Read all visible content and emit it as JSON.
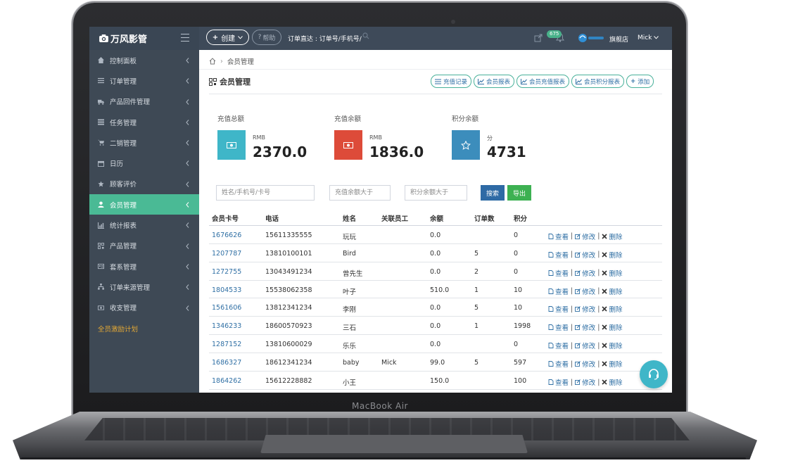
{
  "device": {
    "label": "MacBook Air"
  },
  "app": {
    "name": "万风影管",
    "brand_color": "#3e4a59",
    "accent": "#4aba95"
  },
  "topbar": {
    "create_label": "创建",
    "help_label": "帮助",
    "order_search_label": "订单直达 : 订单号/手机号/",
    "notif_count": "675",
    "store_name": "旗舰店",
    "user_name": "Mick"
  },
  "sidebar": {
    "items": [
      {
        "label": "控制面板",
        "icon": "dashboard-icon"
      },
      {
        "label": "订单管理",
        "icon": "list-icon"
      },
      {
        "label": "产品回件管理",
        "icon": "truck-icon"
      },
      {
        "label": "任务管理",
        "icon": "tasks-icon"
      },
      {
        "label": "二销管理",
        "icon": "cart-icon"
      },
      {
        "label": "日历",
        "icon": "calendar-icon"
      },
      {
        "label": "顾客评价",
        "icon": "star-half-icon"
      },
      {
        "label": "会员管理",
        "icon": "user-icon",
        "active": true
      },
      {
        "label": "统计报表",
        "icon": "bar-chart-icon"
      },
      {
        "label": "产品管理",
        "icon": "qrcode-icon"
      },
      {
        "label": "套系管理",
        "icon": "id-card-icon"
      },
      {
        "label": "订单来源管理",
        "icon": "sitemap-icon"
      },
      {
        "label": "收支管理",
        "icon": "money-icon"
      },
      {
        "label": "全员激励计划",
        "icon": "",
        "special": true
      }
    ]
  },
  "breadcrumb": {
    "current": "会员管理"
  },
  "page": {
    "title": "会员管理",
    "buttons": [
      "充值记录",
      "会员报表",
      "会员充值报表",
      "会员积分报表",
      "添加"
    ]
  },
  "stats": [
    {
      "label": "充值总额",
      "unit": "RMB",
      "value": "2370.0",
      "color": "#3fb6c8",
      "icon": "money-icon"
    },
    {
      "label": "充值余额",
      "unit": "RMB",
      "value": "1836.0",
      "color": "#dd4b39",
      "icon": "money-icon"
    },
    {
      "label": "积分余额",
      "unit": "分",
      "value": "4731",
      "color": "#3c8dbc",
      "icon": "star-icon"
    }
  ],
  "filters": {
    "name_placeholder": "姓名/手机号/卡号",
    "balance_placeholder": "充值余额大于",
    "points_placeholder": "积分余额大于",
    "search_label": "搜索",
    "export_label": "导出"
  },
  "table": {
    "headers": [
      "会员卡号",
      "电话",
      "姓名",
      "关联员工",
      "余额",
      "订单数",
      "积分"
    ],
    "ops": {
      "view": "查看",
      "edit": "修改",
      "delete": "删除",
      "sep": "|"
    },
    "rows": [
      [
        "1676626",
        "15611335555",
        "玩玩",
        "",
        "0.0",
        "",
        "0"
      ],
      [
        "1207787",
        "13810100101",
        "Bird",
        "",
        "0.0",
        "5",
        "0"
      ],
      [
        "1272755",
        "13043491234",
        "曾先生",
        "",
        "0.0",
        "2",
        "0"
      ],
      [
        "1804533",
        "15538062358",
        "叶子",
        "",
        "510.0",
        "1",
        "10"
      ],
      [
        "1561606",
        "13812341234",
        "李刚",
        "",
        "0.0",
        "5",
        "10"
      ],
      [
        "1346233",
        "18600570923",
        "三石",
        "",
        "0.0",
        "1",
        "1998"
      ],
      [
        "1287152",
        "13810600029",
        "乐乐",
        "",
        "0.0",
        "",
        "0"
      ],
      [
        "1686327",
        "18612341234",
        "baby",
        "Mick",
        "99.0",
        "5",
        "597"
      ],
      [
        "1864262",
        "15612228882",
        "小王",
        "",
        "150.0",
        "",
        "100"
      ]
    ]
  }
}
